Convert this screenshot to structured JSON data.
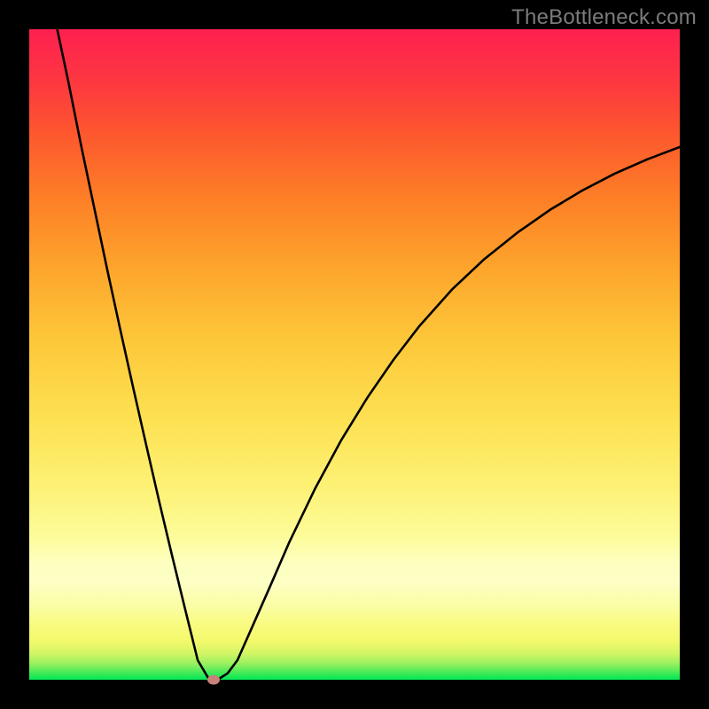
{
  "watermark": "TheBottleneck.com",
  "chart_data": {
    "type": "line",
    "title": "",
    "xlabel": "",
    "ylabel": "",
    "xlim": [
      0,
      100
    ],
    "ylim": [
      0,
      100
    ],
    "background_gradient": {
      "direction": "vertical-bottom-to-top",
      "colors": [
        "#00e756",
        "#fdffc5",
        "#fdc83a",
        "#fd572e",
        "#fd2050"
      ]
    },
    "series": [
      {
        "name": "bottleneck-curve",
        "color": "#000000",
        "x": [
          4.3,
          6,
          8,
          10,
          12,
          14,
          16,
          18,
          20,
          22,
          24,
          25.9,
          27.5,
          28.3,
          29.2,
          30.5,
          32,
          34,
          37,
          40,
          44,
          48,
          52,
          56,
          60,
          65,
          70,
          75,
          80,
          85,
          90,
          95,
          100
        ],
        "y": [
          100,
          92,
          82,
          72.5,
          63,
          53.8,
          44.8,
          36,
          27.3,
          18.9,
          10.7,
          3.0,
          0.3,
          0.0,
          0.15,
          1.0,
          3.0,
          7.5,
          14.3,
          21.2,
          29.5,
          36.9,
          43.4,
          49.2,
          54.4,
          60.0,
          64.7,
          68.7,
          72.2,
          75.2,
          77.8,
          80.0,
          81.9
        ]
      }
    ],
    "marker": {
      "x": 28.3,
      "y": 0.0,
      "color": "#c9827a"
    }
  }
}
